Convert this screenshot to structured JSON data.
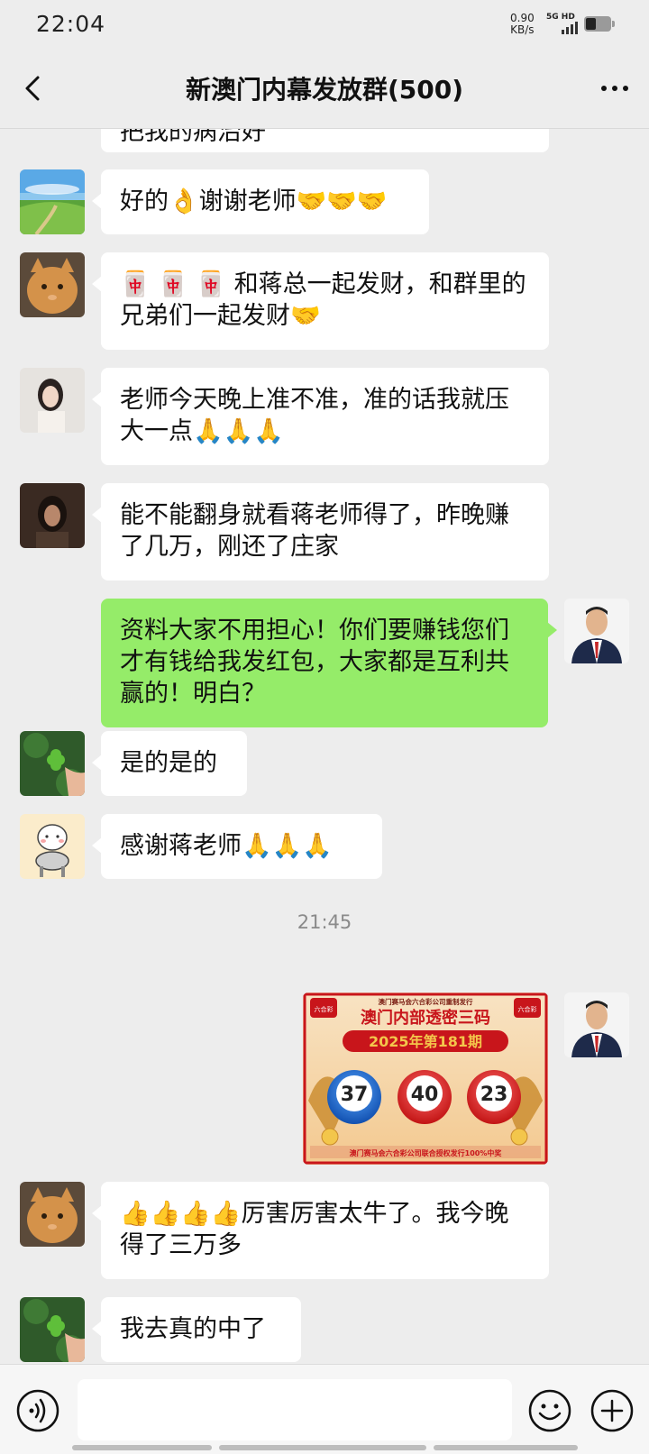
{
  "status_bar": {
    "time": "22:04",
    "net_speed_value": "0.90",
    "net_speed_unit": "KB/s",
    "network_top": "5G HD"
  },
  "header": {
    "title": "新澳门内幕发放群(500)"
  },
  "messages": [
    {
      "text": "把我的病治好"
    },
    {
      "text": "好的👌谢谢老师🤝🤝🤝"
    },
    {
      "text": "🀄 🀄 🀄 和蒋总一起发财，和群里的兄弟们一起发财🤝"
    },
    {
      "text": "老师今天晚上准不准，准的话我就压大一点🙏🙏🙏"
    },
    {
      "text": "能不能翻身就看蒋老师得了，昨晚赚了几万，刚还了庄家"
    },
    {
      "text": "资料大家不用担心！你们要赚钱您们才有钱给我发红包，大家都是互利共赢的！明白？"
    },
    {
      "text": "是的是的"
    },
    {
      "text": "感谢蒋老师🙏🙏🙏"
    },
    {
      "text": "👍👍👍👍厉害厉害太牛了。我今晚得了三万多"
    },
    {
      "text": "我去真的中了"
    }
  ],
  "timestamp": "21:45",
  "lottery_image": {
    "header_line": "澳门赛马会六合彩公司重制发行",
    "title": "澳门内部透密三码",
    "period": "2025年第181期",
    "numbers": [
      "37",
      "40",
      "23"
    ],
    "footer": "澳门赛马会六合彩公司联合授权发行100%中奖",
    "logo_text": "六合彩",
    "colors": {
      "red": "#c8151b",
      "gold": "#f3c64b",
      "blue": "#1d6fc9"
    }
  },
  "colors": {
    "background": "#ededed",
    "outgoing_bubble": "#95ec69",
    "incoming_bubble": "#ffffff"
  }
}
